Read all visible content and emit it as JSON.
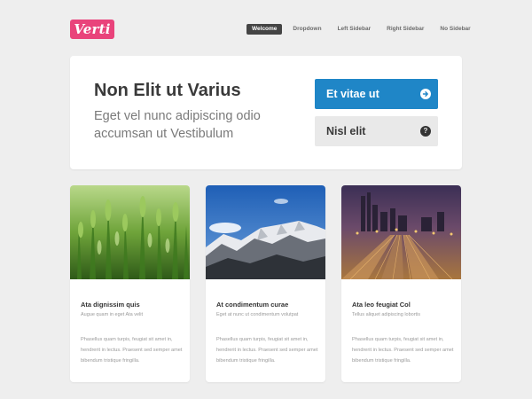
{
  "header": {
    "logo_text": "Verti",
    "nav": [
      {
        "label": "Welcome",
        "active": true
      },
      {
        "label": "Dropdown",
        "active": false
      },
      {
        "label": "Left Sidebar",
        "active": false
      },
      {
        "label": "Right Sidebar",
        "active": false
      },
      {
        "label": "No Sidebar",
        "active": false
      }
    ]
  },
  "banner": {
    "title": "Non Elit ut Varius",
    "subtitle": "Eget vel nunc adipiscing odio accumsan ut Vestibulum",
    "primary_button": {
      "label": "Et vitae ut",
      "icon": "arrow-right-icon"
    },
    "secondary_button": {
      "label": "Nisl elit",
      "icon": "question-icon"
    }
  },
  "cards": [
    {
      "image": "wheat-field",
      "title": "Ata dignissim quis",
      "subtitle": "Augue quam in eget Ata velit",
      "body": "Phasellus quam turpis, feugiat sit amet in, hendrerit in lectus. Praesent sed semper amet bibendum tristique fringilla."
    },
    {
      "image": "snowy-mountains",
      "title": "At condimentum curae",
      "subtitle": "Eget at nunc ut condimentum volutpat",
      "body": "Phasellus quam turpis, feugiat sit amet in, hendrerit in lectus. Praesent sed semper amet bibendum tristique fringilla."
    },
    {
      "image": "city-railway-night",
      "title": "Ata leo feugiat Col",
      "subtitle": "Tellus aliquet adipiscing lobortis",
      "body": "Phasellus quam turpis, feugiat sit amet in, hendrerit in lectus. Praesent sed semper amet bibendum tristique fringilla."
    }
  ],
  "colors": {
    "brand": "#e9437b",
    "primary_button": "#1f86c7",
    "nav_active": "#444444",
    "background": "#eeeeee"
  }
}
